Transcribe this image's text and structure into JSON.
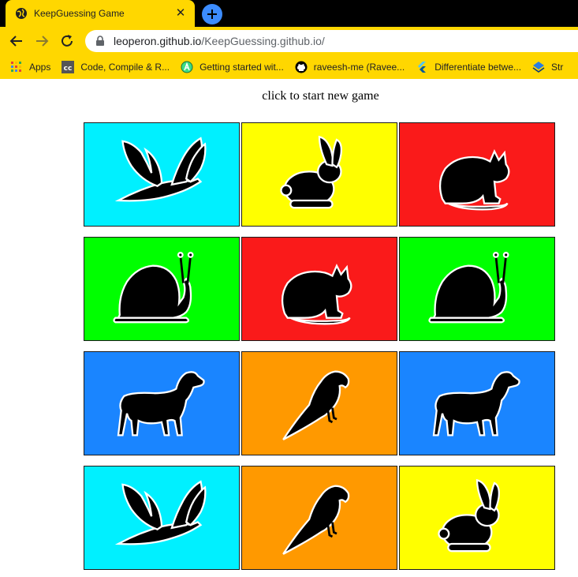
{
  "browser": {
    "tab_title": "KeepGuessing Game",
    "url_host": "leoperon.github.io",
    "url_path": "/KeepGuessing.github.io/",
    "bookmarks": [
      {
        "label": "Apps",
        "icon": "apps-grid-icon"
      },
      {
        "label": "Code, Compile & R...",
        "icon": "cc-icon"
      },
      {
        "label": "Getting started wit...",
        "icon": "android-studio-icon"
      },
      {
        "label": "raveesh-me (Ravee...",
        "icon": "github-icon"
      },
      {
        "label": "Differentiate betwe...",
        "icon": "flutter-icon"
      },
      {
        "label": "Str",
        "icon": "stack-icon"
      }
    ]
  },
  "game": {
    "caption": "click to start new game",
    "cards": [
      {
        "animal": "bird",
        "color": "#00f0ff"
      },
      {
        "animal": "rabbit",
        "color": "#ffff00"
      },
      {
        "animal": "cat",
        "color": "#fa1a1a"
      },
      {
        "animal": "snail",
        "color": "#00ff00"
      },
      {
        "animal": "cat",
        "color": "#fa1a1a"
      },
      {
        "animal": "snail",
        "color": "#00ff00"
      },
      {
        "animal": "dog",
        "color": "#1a85ff"
      },
      {
        "animal": "parrot",
        "color": "#ff9900"
      },
      {
        "animal": "dog",
        "color": "#1a85ff"
      },
      {
        "animal": "bird",
        "color": "#00f0ff"
      },
      {
        "animal": "parrot",
        "color": "#ff9900"
      },
      {
        "animal": "rabbit",
        "color": "#ffff00"
      }
    ]
  }
}
